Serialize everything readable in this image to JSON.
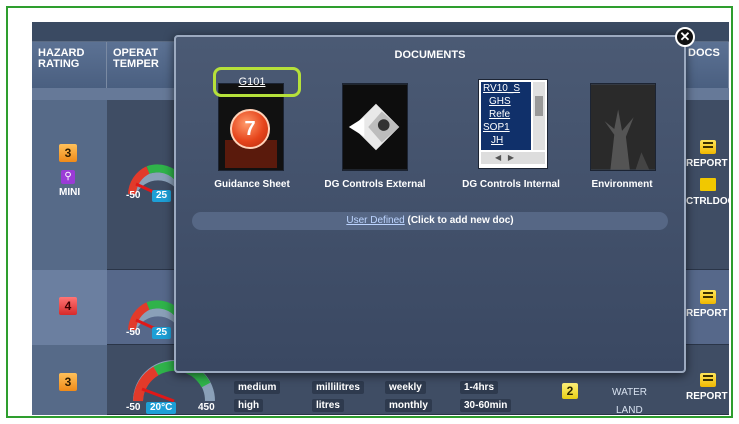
{
  "headers": {
    "hazard_rating": [
      "HAZARD",
      "RATING"
    ],
    "operating_temp": [
      "OPERAT",
      "TEMPER"
    ],
    "docs": "DOCS"
  },
  "rows": [
    {
      "hazard": "3",
      "hazard_color": "#f08a18",
      "mini_label": "MINI",
      "gauge_min": "-50",
      "gauge_val": "25",
      "docs": {
        "report": "REPORT",
        "ctrl": "CTRLDOC"
      }
    },
    {
      "hazard": "4",
      "hazard_color": "#d62a2a",
      "gauge_min": "-50",
      "gauge_val": "25",
      "docs": {
        "report": "REPORT"
      }
    },
    {
      "hazard": "3",
      "hazard_color": "#f08a18",
      "gauge_min": "-50",
      "gauge_val": "20°C",
      "gauge_max": "450",
      "cells": {
        "size": [
          "medium",
          "high"
        ],
        "volume": [
          "millilitres",
          "litres"
        ],
        "frequency": [
          "weekly",
          "monthly"
        ],
        "duration": [
          "1-4hrs",
          "30-60min"
        ],
        "badge": "2",
        "env": [
          "WATER",
          "LAND"
        ]
      },
      "docs": {
        "report": "REPORT"
      }
    }
  ],
  "modal": {
    "title": "DOCUMENTS",
    "close_icon": "close-icon",
    "documents": [
      {
        "label": "Guidance Sheet",
        "thumb_code": "G101",
        "notification_count": "7"
      },
      {
        "label": "DG Controls External"
      },
      {
        "label": "DG Controls Internal",
        "list_items": [
          "RV10_S",
          "GHS",
          "Refe",
          "SOP1",
          "JH"
        ]
      },
      {
        "label": "Environment"
      }
    ],
    "user_defined": {
      "link": "User Defined",
      "hint": "(Click to add new doc)"
    }
  },
  "colors": {
    "frame_border": "#2e9e2e",
    "highlight": "#b6e13a",
    "app_bg": "#3e4c62",
    "header_bg": "#5c7294"
  }
}
